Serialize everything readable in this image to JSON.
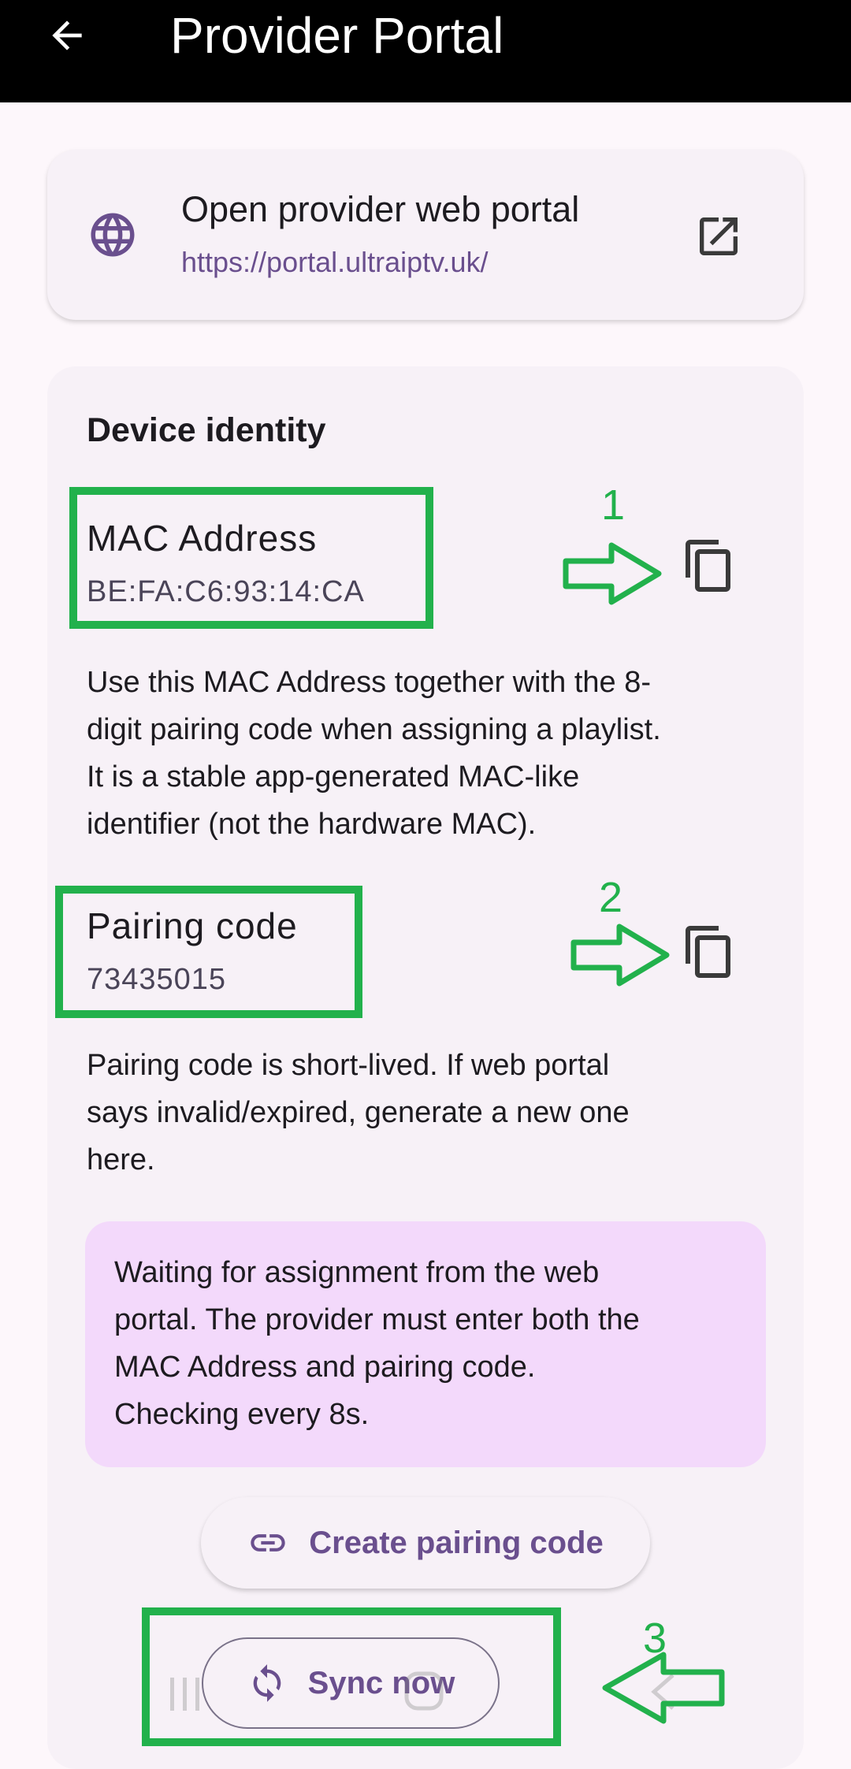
{
  "appbar": {
    "title": "Provider Portal",
    "back_icon": "arrow-left-icon"
  },
  "portal_card": {
    "title": "Open provider web portal",
    "url": "https://portal.ultraiptv.uk/",
    "leading_icon": "globe-icon",
    "trailing_icon": "open-external-icon"
  },
  "identity": {
    "section_title": "Device identity",
    "mac_label": "MAC Address",
    "mac_value": "BE:FA:C6:93:14:CA",
    "mac_help_lines": [
      "Use this MAC Address together with the 8-",
      "digit pairing code when assigning a playlist.",
      "It is a stable app-generated MAC-like",
      "identifier (not the hardware MAC)."
    ],
    "pairing_label": "Pairing code",
    "pairing_value": "73435015",
    "pairing_help_lines": [
      "Pairing code is short-lived. If web portal",
      "says invalid/expired, generate a new one",
      "here."
    ],
    "status_lines": [
      "Waiting for assignment from the web",
      "portal. The provider must enter both the",
      "MAC Address and pairing code.",
      "Checking every 8s."
    ],
    "create_button": "Create pairing code",
    "sync_button": "Sync now"
  },
  "annotations": {
    "n1": "1",
    "n2": "2",
    "n3": "3"
  },
  "colors": {
    "accent": "#6a4f8e",
    "highlight": "#22b14c",
    "status_bg": "#f3d9fb"
  }
}
